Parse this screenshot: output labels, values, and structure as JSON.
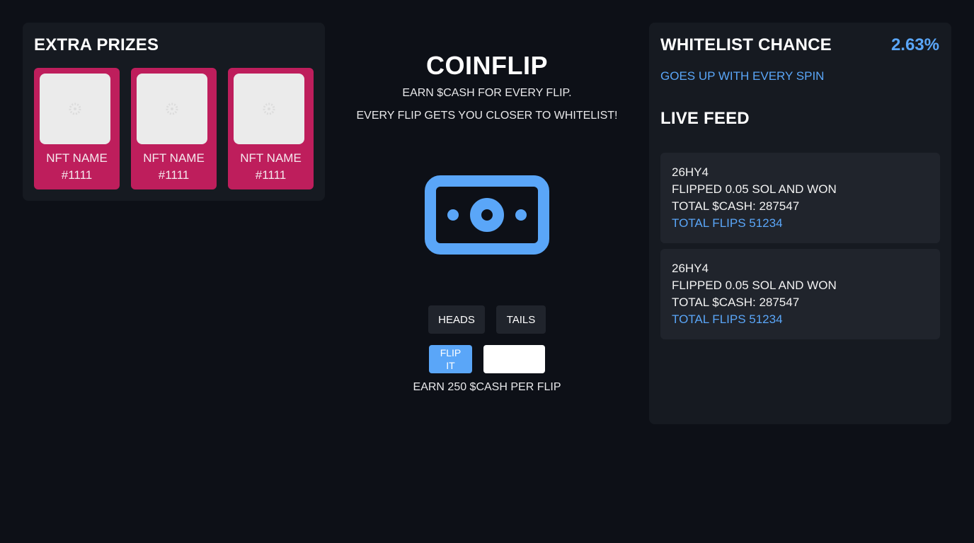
{
  "prizes": {
    "title": "EXTRA PRIZES",
    "items": [
      {
        "name": "NFT NAME",
        "number": "#1111",
        "icon": "image-placeholder-icon"
      },
      {
        "name": "NFT NAME",
        "number": "#1111",
        "icon": "image-placeholder-icon"
      },
      {
        "name": "NFT NAME",
        "number": "#1111",
        "icon": "image-placeholder-icon"
      }
    ]
  },
  "game": {
    "title": "COINFLIP",
    "subtitle_1": "EARN $CASH FOR EVERY FLIP.",
    "subtitle_2": "EVERY FLIP GETS YOU CLOSER TO WHITELIST!",
    "icon": "cash-icon",
    "heads_label": "HEADS",
    "tails_label": "TAILS",
    "flip_label": "FLIP IT",
    "amount_value": "",
    "earn_text": "EARN 250 $CASH PER FLIP"
  },
  "whitelist": {
    "title": "WHITELIST CHANCE",
    "value": "2.63%",
    "subtitle": "GOES UP WITH EVERY SPIN",
    "feed_title": "LIVE FEED",
    "feed": [
      {
        "user": "26HY4",
        "action": "FLIPPED 0.05 SOL AND WON",
        "total_cash": "TOTAL $CASH: 287547",
        "total_flips": "TOTAL FLIPS 51234"
      },
      {
        "user": "26HY4",
        "action": "FLIPPED 0.05 SOL AND WON",
        "total_cash": "TOTAL $CASH: 287547",
        "total_flips": "TOTAL FLIPS 51234"
      }
    ]
  },
  "colors": {
    "background": "#0d1017",
    "panel": "#161a21",
    "accent": "#5aa6f8",
    "prize_card": "#be1e5c"
  }
}
